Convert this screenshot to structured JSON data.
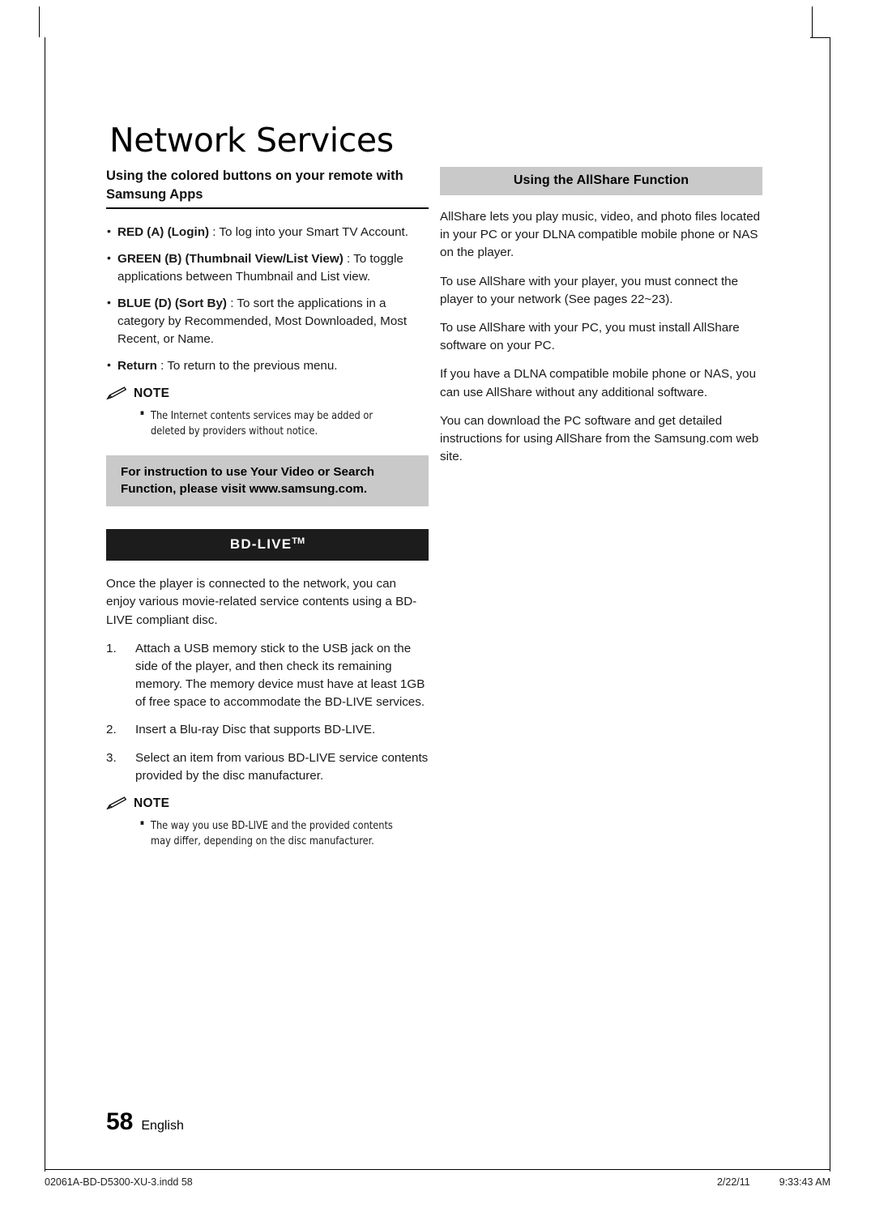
{
  "document": {
    "chapter_title": "Network Services",
    "page_number": "58",
    "page_language": "English",
    "footer": {
      "file_name": "02061A-BD-D5300-XU-3.indd   58",
      "date": "2/22/11",
      "time": "9:33:43 AM"
    }
  },
  "left_column": {
    "heading": "Using the colored buttons on your remote with Samsung Apps",
    "bullets": [
      {
        "bold": "RED (A) (Login)",
        "rest": " : To log into your Smart TV Account."
      },
      {
        "bold": "GREEN (B) (Thumbnail View/List View)",
        "rest": " : To toggle applications between Thumbnail and List view."
      },
      {
        "bold": "BLUE (D) (Sort By)",
        "rest": " : To sort the applications in a category by Recommended, Most Downloaded, Most Recent, or Name."
      },
      {
        "bold": "Return",
        "rest": " : To return to the previous menu."
      }
    ],
    "note": {
      "label": "NOTE",
      "items": [
        "The Internet contents services may be added or deleted by providers without notice."
      ]
    },
    "callout": "For instruction to use Your Video or Search Function, please visit www.samsung.com.",
    "bdlive": {
      "heading": "BD-LIVE",
      "trademark": "TM",
      "intro": "Once the player is connected to the network, you can enjoy various movie-related service contents using a BD-LIVE compliant disc.",
      "steps": [
        {
          "num": "1.",
          "text": "Attach a USB memory stick to the USB jack on the side of the player, and then check its remaining memory. The memory device must have at least 1GB of free space to accommodate the BD-LIVE services."
        },
        {
          "num": "2.",
          "text": "Insert a Blu-ray Disc that supports BD-LIVE."
        },
        {
          "num": "3.",
          "text": "Select an item from various BD-LIVE service contents provided by the disc manufacturer."
        }
      ],
      "note": {
        "label": "NOTE",
        "items": [
          "The way you use BD-LIVE and the provided contents may differ, depending on the disc manufacturer."
        ]
      }
    }
  },
  "right_column": {
    "heading": "Using the AllShare Function",
    "paragraphs": [
      "AllShare lets you play music, video, and photo files located in your PC or your DLNA compatible mobile phone or NAS on the player.",
      "To use AllShare with your player, you must connect the player to your network (See pages 22~23).",
      "To use AllShare with your PC, you must install AllShare software on your PC.",
      "If you have a DLNA compatible mobile phone or NAS, you can use AllShare without any additional software.",
      "You can download the PC software and get detailed instructions for using AllShare from the Samsung.com web site."
    ]
  }
}
